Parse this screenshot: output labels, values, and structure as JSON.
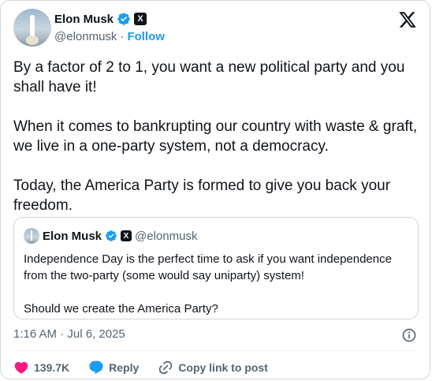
{
  "author": {
    "display_name": "Elon Musk",
    "handle": "@elonmusk",
    "separator": "·",
    "follow_label": "Follow",
    "affiliate_badge": "X"
  },
  "brand": {
    "logo": "x-logo-icon"
  },
  "tweet": {
    "paragraphs": [
      "By a factor of 2 to 1, you want a new political party and you shall have it!",
      "When it comes to bankrupting our country with waste & graft, we live in a one-party system, not a democracy.",
      "Today, the America Party is formed to give you back your freedom."
    ]
  },
  "quote": {
    "display_name": "Elon Musk",
    "handle": "@elonmusk",
    "affiliate_badge": "X",
    "paragraphs": [
      "Independence Day is the perfect time to ask if you want independence from the two-party (some would say uniparty) system!",
      "Should we create the America Party?"
    ]
  },
  "meta": {
    "timestamp": "1:16 AM · Jul 6, 2025"
  },
  "actions": {
    "like_count": "139.7K",
    "reply_label": "Reply",
    "copy_link_label": "Copy link to post"
  },
  "colors": {
    "accent": "#1d9bf0",
    "like": "#f91880",
    "secondary_text": "#536471",
    "border": "#cfd9de"
  }
}
